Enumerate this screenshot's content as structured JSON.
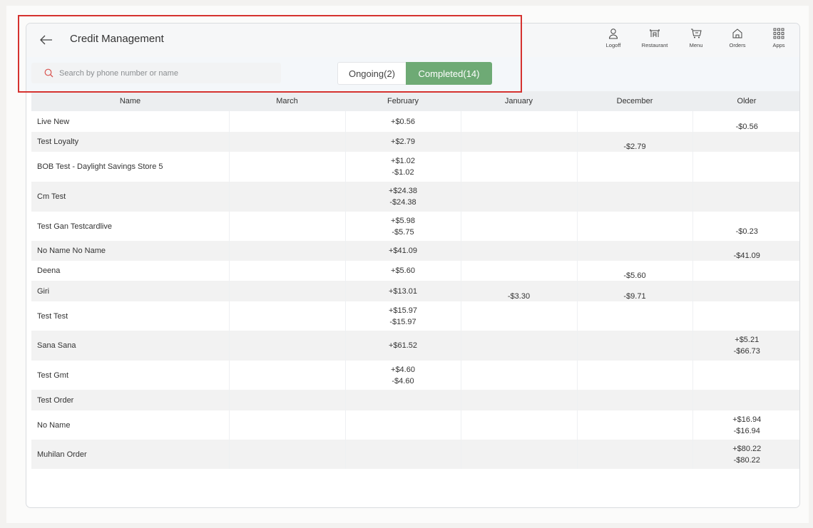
{
  "header": {
    "title": "Credit Management",
    "nav": [
      {
        "label": "Logoff",
        "icon": "user-icon"
      },
      {
        "label": "Restaurant",
        "icon": "restaurant-icon"
      },
      {
        "label": "Menu",
        "icon": "cart-icon"
      },
      {
        "label": "Orders",
        "icon": "home-icon"
      },
      {
        "label": "Apps",
        "icon": "grid-icon"
      }
    ]
  },
  "search": {
    "placeholder": "Search by phone number or name",
    "value": ""
  },
  "tabs": {
    "ongoing": "Ongoing(2)",
    "completed": "Completed(14)",
    "active": "completed"
  },
  "colors": {
    "accent": "#6eaa75",
    "highlight": "#d5322f"
  },
  "table": {
    "columns": [
      "Name",
      "March",
      "February",
      "January",
      "December",
      "Older"
    ],
    "rows": [
      {
        "name": "Live New",
        "march": "",
        "february": "+$0.56",
        "january": "",
        "december": "",
        "older": "-$0.56"
      },
      {
        "name": "Test Loyalty",
        "march": "",
        "february": "+$2.79",
        "january": "",
        "december": "-$2.79",
        "older": ""
      },
      {
        "name": "BOB Test - Daylight Savings Store 5",
        "march": "",
        "february": "+$1.02\n-$1.02",
        "january": "",
        "december": "",
        "older": ""
      },
      {
        "name": "Cm Test",
        "march": "",
        "february": "+$24.38\n-$24.38",
        "january": "",
        "december": "",
        "older": ""
      },
      {
        "name": "Test Gan Testcardlive",
        "march": "",
        "february": "+$5.98\n-$5.75",
        "january": "",
        "december": "",
        "older": "-$0.23"
      },
      {
        "name": "No Name No Name",
        "march": "",
        "february": "+$41.09",
        "january": "",
        "december": "",
        "older": "-$41.09"
      },
      {
        "name": "Deena",
        "march": "",
        "february": "+$5.60",
        "january": "",
        "december": "-$5.60",
        "older": ""
      },
      {
        "name": "Giri",
        "march": "",
        "february": "+$13.01",
        "january": "-$3.30",
        "december": "-$9.71",
        "older": ""
      },
      {
        "name": "Test Test",
        "march": "",
        "february": "+$15.97\n-$15.97",
        "january": "",
        "december": "",
        "older": ""
      },
      {
        "name": "Sana Sana",
        "march": "",
        "february": "+$61.52",
        "january": "",
        "december": "",
        "older": "+$5.21\n-$66.73"
      },
      {
        "name": "Test Gmt",
        "march": "",
        "february": "+$4.60\n-$4.60",
        "january": "",
        "december": "",
        "older": ""
      },
      {
        "name": "Test Order",
        "march": "",
        "february": "",
        "january": "",
        "december": "",
        "older": ""
      },
      {
        "name": "No Name",
        "march": "",
        "february": "",
        "january": "",
        "december": "",
        "older": "+$16.94\n-$16.94"
      },
      {
        "name": "Muhilan Order",
        "march": "",
        "february": "",
        "january": "",
        "december": "",
        "older": "+$80.22\n-$80.22"
      }
    ]
  }
}
